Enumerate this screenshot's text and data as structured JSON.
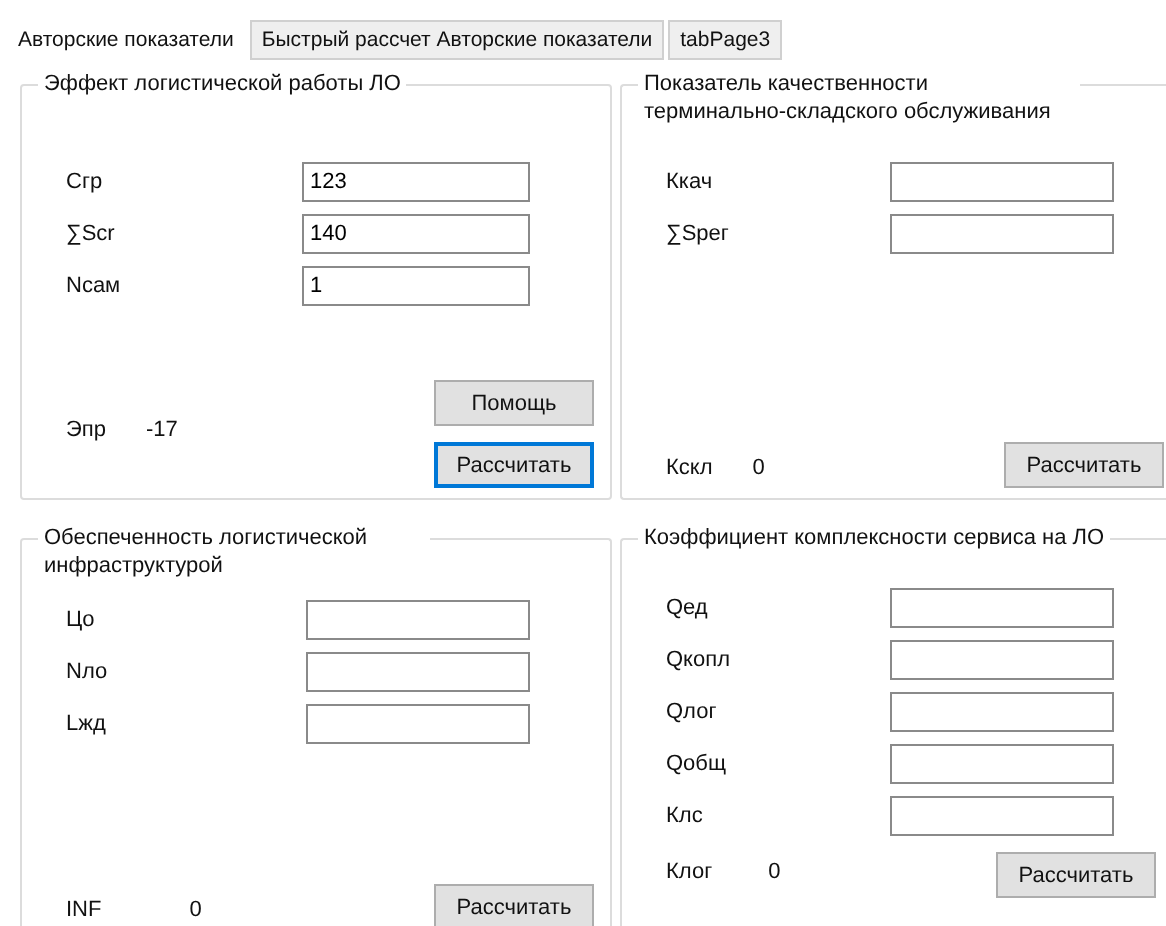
{
  "tabs": [
    {
      "label": "Авторские показатели",
      "selected": true
    },
    {
      "label": "Быстрый рассчет Авторские показатели",
      "selected": false
    },
    {
      "label": "tabPage3",
      "selected": false
    }
  ],
  "groups": [
    {
      "title": "Эффект логистической работы ЛО",
      "fields": [
        {
          "label": "Cгр",
          "value": "123"
        },
        {
          "label": "∑Scr",
          "value": "140"
        },
        {
          "label": "Nсам",
          "value": "1"
        }
      ],
      "result": {
        "label": "Эпр",
        "value": "-17"
      },
      "buttons": [
        {
          "label": "Помощь",
          "focused": false
        },
        {
          "label": "Рассчитать",
          "focused": true
        }
      ]
    },
    {
      "title": "Показатель качественности терминально-складского обслуживания",
      "fields": [
        {
          "label": "Ккач"
        },
        {
          "label": "∑Sрег"
        }
      ],
      "result": {
        "label": "Кскл",
        "value": "0"
      },
      "buttons": [
        {
          "label": "Рассчитать",
          "focused": false
        }
      ]
    },
    {
      "title": "Обеспеченность логистической инфраструктурой",
      "fields": [
        {
          "label": "Цо"
        },
        {
          "label": "Nло"
        },
        {
          "label": "Lжд"
        }
      ],
      "result": {
        "label": "INF",
        "value": "0"
      },
      "buttons": [
        {
          "label": "Рассчитать",
          "focused": false
        }
      ]
    },
    {
      "title": "Коэффициент комплексности сервиса на ЛО",
      "fields": [
        {
          "label": "Qед"
        },
        {
          "label": "Qкопл"
        },
        {
          "label": "Qлог"
        },
        {
          "label": "Qобщ"
        },
        {
          "label": "Клс"
        }
      ],
      "result": {
        "label": "Клог",
        "value": "0"
      },
      "buttons": [
        {
          "label": "Рассчитать",
          "focused": false
        }
      ]
    }
  ]
}
